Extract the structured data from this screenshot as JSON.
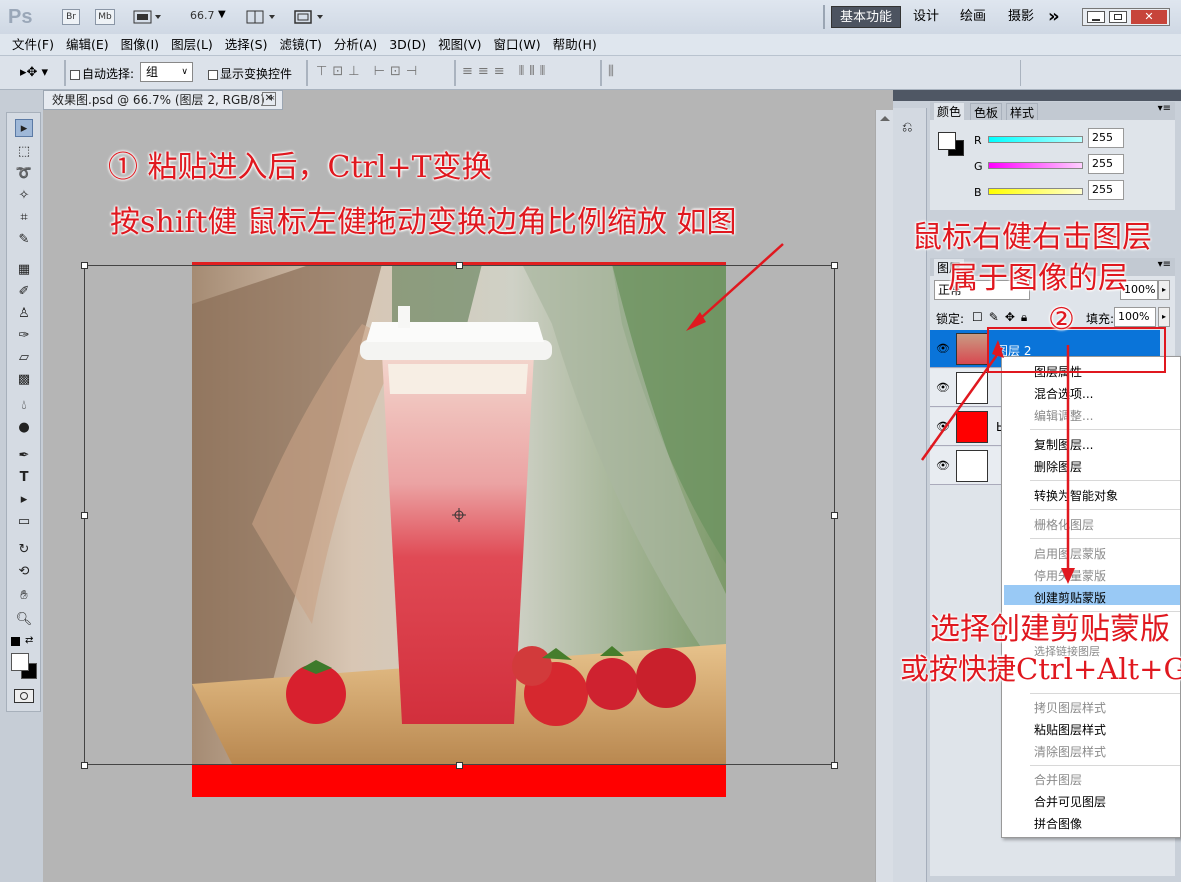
{
  "app": {
    "logo": "Ps",
    "br": "Br",
    "mb": "Mb",
    "zoom": "66.7",
    "workspaces": [
      "基本功能",
      "设计",
      "绘画",
      "摄影"
    ],
    "more": "»"
  },
  "menu": [
    "文件(F)",
    "编辑(E)",
    "图像(I)",
    "图层(L)",
    "选择(S)",
    "滤镜(T)",
    "分析(A)",
    "3D(D)",
    "视图(V)",
    "窗口(W)",
    "帮助(H)"
  ],
  "options": {
    "auto_select_label": "自动选择:",
    "auto_select_value": "组",
    "show_transform_label": "显示变换控件"
  },
  "document": {
    "tab_title": "效果图.psd @ 66.7% (图层 2, RGB/8) *",
    "close": "✕"
  },
  "color_panel": {
    "tabs": [
      "颜色",
      "色板",
      "样式"
    ],
    "channels": [
      {
        "label": "R",
        "value": "255",
        "color": "#00ffff"
      },
      {
        "label": "G",
        "value": "255",
        "color": "#ff00ff"
      },
      {
        "label": "B",
        "value": "255",
        "color": "#ffff00"
      }
    ]
  },
  "layers_panel": {
    "tab": "图层",
    "blend_mode": "正常",
    "opacity": "100%",
    "lock_label": "锁定:",
    "fill_label": "填充:",
    "fill_value": "100%",
    "layers": [
      {
        "name": "图层 2",
        "selected": true
      },
      {
        "name": "",
        "selected": false
      },
      {
        "name": "Ы",
        "selected": false
      },
      {
        "name": "",
        "selected": false
      }
    ]
  },
  "context_menu": {
    "items": [
      {
        "label": "图层属性",
        "enabled": true
      },
      {
        "label": "混合选项...",
        "enabled": true
      },
      {
        "label": "编辑调整...",
        "enabled": false
      },
      {
        "label": "复制图层...",
        "enabled": true
      },
      {
        "label": "删除图层",
        "enabled": true
      },
      {
        "label": "转换为智能对象",
        "enabled": true
      },
      {
        "label": "栅格化图层",
        "enabled": false
      },
      {
        "label": "启用图层蒙版",
        "enabled": false
      },
      {
        "label": "停用矢量蒙版",
        "enabled": false
      },
      {
        "label": "创建剪贴蒙版",
        "enabled": true,
        "highlighted": true
      },
      {
        "label": "选择链接图层",
        "enabled": false
      },
      {
        "label": "拷贝图层样式",
        "enabled": false
      },
      {
        "label": "粘贴图层样式",
        "enabled": true
      },
      {
        "label": "清除图层样式",
        "enabled": false
      },
      {
        "label": "合并图层",
        "enabled": false
      },
      {
        "label": "合并可见图层",
        "enabled": true
      },
      {
        "label": "拼合图像",
        "enabled": true
      }
    ]
  },
  "annotations": {
    "step1_line1": "① 粘贴进入后，Ctrl+T变换",
    "step1_line2": "按shift健  鼠标左健拖动变换边角比例缩放  如图",
    "right_click_line1": "鼠标右健右击图层",
    "right_click_line2": "属于图像的层",
    "step2": "②",
    "choose_line1": "选择创建剪贴蒙版",
    "choose_line2": "或按快捷Ctrl+Alt+G"
  },
  "colors": {
    "annotation_red": "#e0181f",
    "highlight_blue": "#0a74d9",
    "menu_highlight": "#99c9f5",
    "canvas_red": "#ff0000"
  }
}
